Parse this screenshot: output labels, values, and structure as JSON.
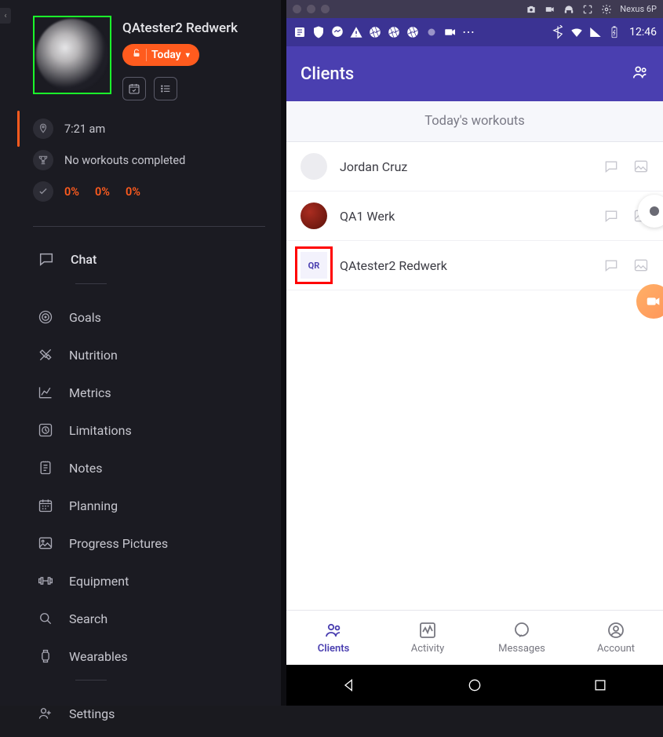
{
  "leftPanel": {
    "profile": {
      "name": "QAtester2 Redwerk",
      "todayLabel": "Today"
    },
    "status": {
      "time": "7:21 am",
      "workouts": "No workouts completed",
      "percents": [
        "0%",
        "0%",
        "0%"
      ]
    },
    "nav": {
      "chat": "Chat",
      "goals": "Goals",
      "nutrition": "Nutrition",
      "metrics": "Metrics",
      "limitations": "Limitations",
      "notes": "Notes",
      "planning": "Planning",
      "progress": "Progress Pictures",
      "equipment": "Equipment",
      "search": "Search",
      "wearables": "Wearables",
      "settings": "Settings"
    }
  },
  "rightPanel": {
    "emulator": {
      "device": "Nexus 6P"
    },
    "statusBar": {
      "time": "12:46"
    },
    "header": {
      "title": "Clients"
    },
    "banner": "Today's workouts",
    "clients": [
      {
        "name": "Jordan Cruz",
        "initials": ""
      },
      {
        "name": "QA1 Werk",
        "initials": ""
      },
      {
        "name": "QAtester2 Redwerk",
        "initials": "QR"
      }
    ],
    "tabs": {
      "clients": "Clients",
      "activity": "Activity",
      "messages": "Messages",
      "account": "Account"
    }
  }
}
